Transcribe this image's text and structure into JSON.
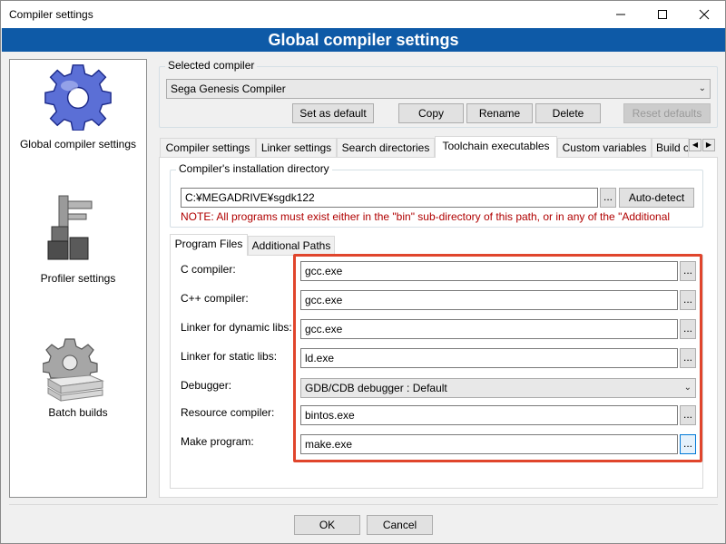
{
  "window": {
    "title": "Compiler settings",
    "banner": "Global compiler settings"
  },
  "sidebar": {
    "items": [
      {
        "label": "Global compiler settings",
        "icon": "gear-icon",
        "selected": true
      },
      {
        "label": "Profiler settings",
        "icon": "profiler-icon",
        "selected": false
      },
      {
        "label": "Batch builds",
        "icon": "batch-builds-icon",
        "selected": false
      }
    ]
  },
  "compiler": {
    "group_title": "Selected compiler",
    "selected": "Sega Genesis Compiler",
    "buttons": {
      "set_default": "Set as default",
      "copy": "Copy",
      "rename": "Rename",
      "delete": "Delete",
      "reset_defaults": "Reset defaults"
    }
  },
  "tabs": {
    "items": [
      "Compiler settings",
      "Linker settings",
      "Search directories",
      "Toolchain executables",
      "Custom variables",
      "Build options"
    ],
    "active": "Toolchain executables"
  },
  "install_dir": {
    "group_title": "Compiler's installation directory",
    "value": "C:¥MEGADRIVE¥sgdk122",
    "browse": "...",
    "auto_detect": "Auto-detect",
    "note": "NOTE: All programs must exist either in the \"bin\" sub-directory of this path, or in any of the \"Additional"
  },
  "subtabs": {
    "items": [
      "Program Files",
      "Additional Paths"
    ],
    "active": "Program Files"
  },
  "programs": {
    "c_compiler": {
      "label": "C compiler:",
      "value": "gcc.exe"
    },
    "cpp_compiler": {
      "label": "C++ compiler:",
      "value": "gcc.exe"
    },
    "linker_dynamic": {
      "label": "Linker for dynamic libs:",
      "value": "gcc.exe"
    },
    "linker_static": {
      "label": "Linker for static libs:",
      "value": "ld.exe"
    },
    "debugger": {
      "label": "Debugger:",
      "value": "GDB/CDB debugger : Default"
    },
    "resource_compiler": {
      "label": "Resource compiler:",
      "value": "bintos.exe"
    },
    "make_program": {
      "label": "Make program:",
      "value": "make.exe"
    },
    "browse": "..."
  },
  "footer": {
    "ok": "OK",
    "cancel": "Cancel"
  },
  "colors": {
    "banner": "#0e5aa7",
    "highlight": "#e0452c",
    "note": "#b00000",
    "focus": "#0078d7"
  }
}
